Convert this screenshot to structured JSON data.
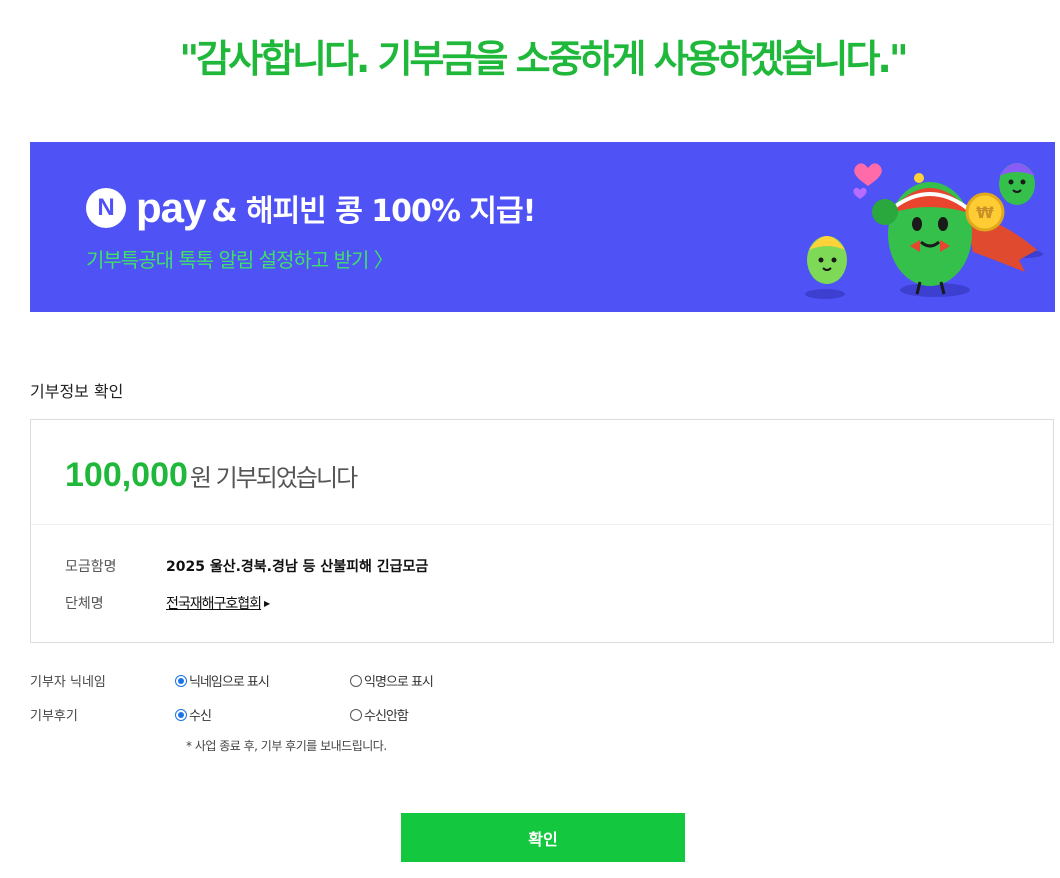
{
  "headline": "\"감사합니다. 기부금을 소중하게 사용하겠습니다.\"",
  "banner": {
    "logo_letter": "N",
    "pay_word": "pay",
    "title": "& 해피빈 콩 100% 지급!",
    "subtitle": "기부특공대 톡톡 알림 설정하고 받기 〉",
    "bg_color": "#4f52f5",
    "subtitle_color": "#3ee06a"
  },
  "section_title": "기부정보 확인",
  "donation": {
    "amount": "100,000",
    "amount_suffix": "원 기부되었습니다",
    "accent_color": "#1fb83b",
    "rows": [
      {
        "label": "모금함명",
        "value": "2025 울산.경북.경남 등 산불피해 긴급모금"
      },
      {
        "label": "단체명",
        "value": "전국재해구호협회"
      }
    ]
  },
  "options": {
    "nickname": {
      "label": "기부자 닉네임",
      "choices": [
        "닉네임으로 표시",
        "익명으로 표시"
      ],
      "selected": "닉네임으로 표시"
    },
    "review": {
      "label": "기부후기",
      "choices": [
        "수신",
        "수신안함"
      ],
      "selected": "수신"
    },
    "note": "* 사업 종료 후, 기부 후기를 보내드립니다."
  },
  "confirm_button": {
    "label": "확인",
    "color": "#13c73e"
  }
}
